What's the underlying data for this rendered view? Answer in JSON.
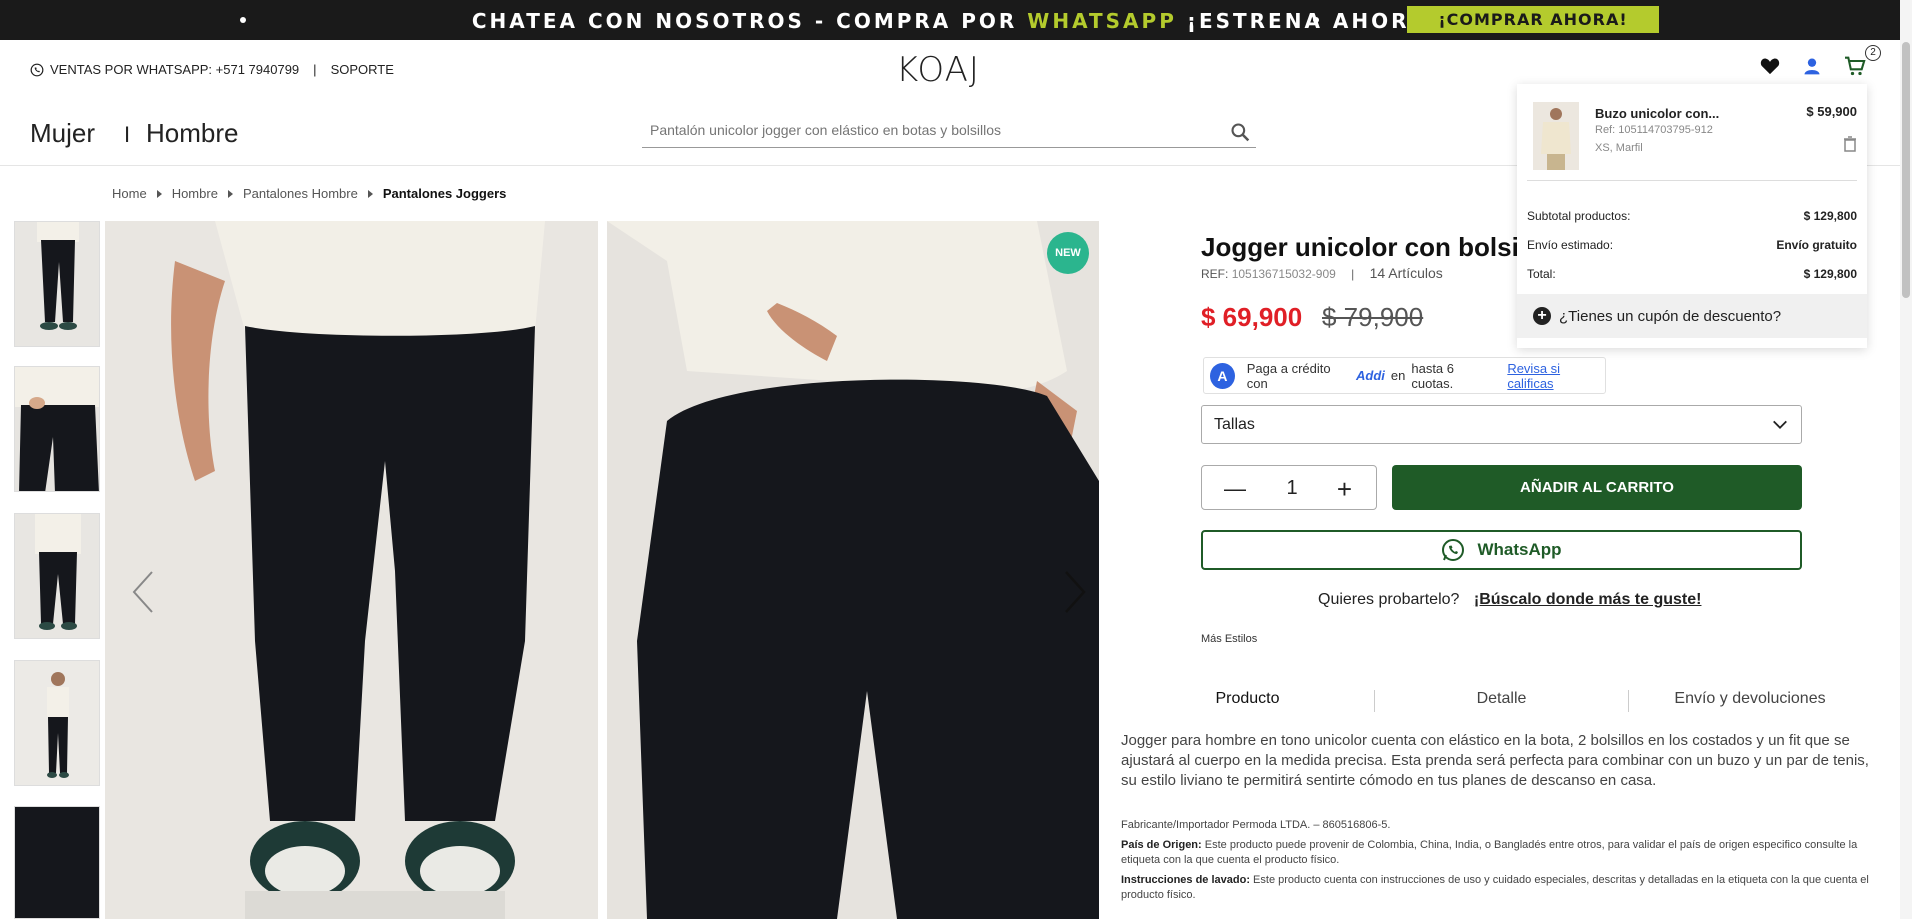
{
  "promo": {
    "message_part1": "CHATEA CON NOSOTROS - COMPRA POR ",
    "message_highlight": "WHATSAPP",
    "message_part2": " ¡ESTRENA AHORA!",
    "buy_button": "¡COMPRAR AHORA!"
  },
  "header": {
    "whatsapp_sales": "VENTAS POR WHATSAPP: +571 7940799",
    "separator": "|",
    "support": "SOPORTE",
    "logo": "KOAJ",
    "cart_count": "2"
  },
  "nav": {
    "women": "Mujer",
    "divider": "I",
    "men": "Hombre",
    "search_placeholder": "Pantalón unicolor jogger con elástico en botas y bolsillos"
  },
  "breadcrumb": [
    "Home",
    "Hombre",
    "Pantalones Hombre",
    "Pantalones Joggers"
  ],
  "gallery": {
    "badge": "NEW"
  },
  "product": {
    "title": "Jogger unicolor con bolsil",
    "ref_label": "REF:",
    "ref_code": "105136715032-909",
    "ref_sep": "|",
    "articles": "14 Artículos",
    "price": "$ 69,900",
    "old_price": "$ 79,900",
    "addi": {
      "logo_letter": "A",
      "text_before": "Paga a crédito con",
      "brand": "Addi",
      "text_after": "en",
      "installments": "hasta 6 cuotas.",
      "link": "Revisa si calificas"
    },
    "sizes_label": "Tallas",
    "quantity": "1",
    "add_to_cart": "AÑADIR AL CARRITO",
    "whatsapp_button": "WhatsApp",
    "try_on_question": "Quieres probartelo?",
    "try_on_link": "¡Búscalo donde más te guste!",
    "more_styles": "Más Estilos",
    "tabs": [
      "Producto",
      "Detalle",
      "Envío y devoluciones"
    ],
    "description": "Jogger para hombre en tono unicolor cuenta con elástico en la bota, 2 bolsillos en los costados y un fit que se ajustará al cuerpo en la medida precisa. Esta prenda será perfecta para combinar con un buzo y un par de tenis, su estilo liviano te permitirá sentirte cómodo en tus planes de descanso en casa.",
    "manufacturer": "Fabricante/Importador Permoda LTDA. – 860516806-5.",
    "origin_label": "País de Origen:",
    "origin_text": "Este producto puede provenir de Colombia, China, India, o Bangladés entre otros, para validar el país de origen especifico consulte la etiqueta con la que cuenta el producto físico.",
    "wash_label": "Instrucciones de lavado:",
    "wash_text": "Este producto cuenta con instrucciones de uso y cuidado especiales, descritas y detalladas en la etiqueta con la que cuenta el producto físico."
  },
  "cart_popup": {
    "item_name": "Buzo unicolor con...",
    "item_ref": "Ref: 105114703795-912",
    "item_variant": "XS, Marfil",
    "item_price": "$ 59,900",
    "subtotal_label": "Subtotal productos:",
    "subtotal_value": "$ 129,800",
    "shipping_label": "Envío estimado:",
    "shipping_value": "Envío gratuito",
    "total_label": "Total:",
    "total_value": "$ 129,800",
    "coupon": "¿Tienes un cupón de descuento?"
  },
  "colors": {
    "promo_bg": "#1a1a1a",
    "promo_accent": "#b4cb2d",
    "sale_price": "#e01f26",
    "primary_green": "#1f5b27",
    "addi_blue": "#2d62e0",
    "new_badge": "#2bb58e"
  }
}
